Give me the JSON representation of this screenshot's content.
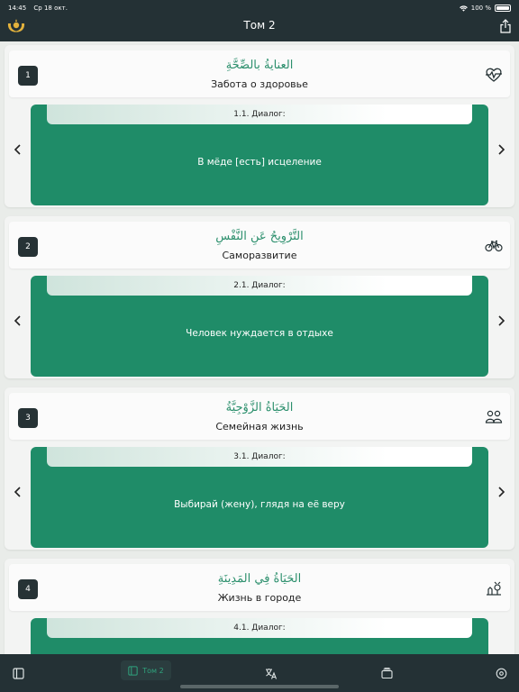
{
  "status": {
    "time": "14:45",
    "date": "Ср 18 окт.",
    "battery": "100 %"
  },
  "header": {
    "title": "Том 2"
  },
  "lessons": [
    {
      "number": "1",
      "arabic": "العنايةُ بالصِّحَّةِ",
      "title": "Забота о здоровье",
      "icon": "heartbeat-icon",
      "slide_label": "1.1. Диалог:",
      "slide_text": "В мёде [есть] исцеление"
    },
    {
      "number": "2",
      "arabic": "التَّرْوِيحُ عَنِ النَّفْسِ",
      "title": "Саморазвитие",
      "icon": "bicycle-icon",
      "slide_label": "2.1. Диалог:",
      "slide_text": "Человек нуждается в отдыхе"
    },
    {
      "number": "3",
      "arabic": "الحَيَاةُ الزَّوْجِيَّةُ",
      "title": "Семейная жизнь",
      "icon": "family-icon",
      "slide_label": "3.1. Диалог:",
      "slide_text": "Выбирай (жену), глядя на её веру"
    },
    {
      "number": "4",
      "arabic": "الحَيَاةُ فِي المَدِينَةِ",
      "title": "Жизнь в городе",
      "icon": "city-icon",
      "slide_label": "4.1. Диалог:",
      "slide_text": ""
    }
  ],
  "tabbar": {
    "active_label": "Том 2"
  },
  "colors": {
    "primary": "#1f8c68",
    "dark": "#243135",
    "accent": "#2fa37d"
  }
}
